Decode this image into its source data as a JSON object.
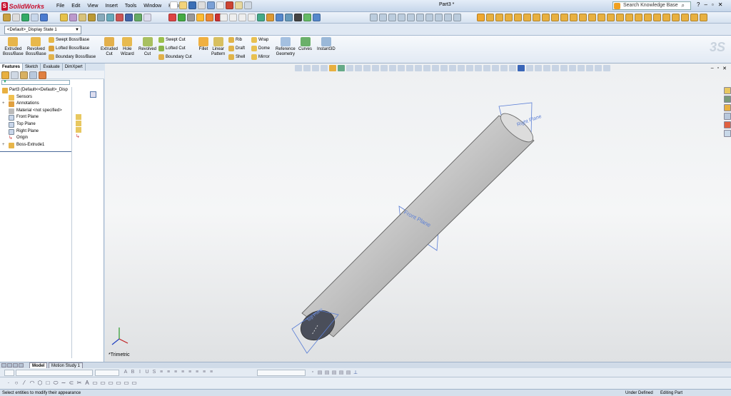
{
  "app": {
    "name": "SolidWorks",
    "doc_title": "Part3 *"
  },
  "menu": [
    "File",
    "Edit",
    "View",
    "Insert",
    "Tools",
    "Window",
    "Help"
  ],
  "search": {
    "placeholder": "Search Knowledge Base"
  },
  "config": {
    "selected": "<Default>_Display State 1"
  },
  "commands": {
    "extruded_boss": "Extruded\nBoss/Base",
    "revolved_boss": "Revolved\nBoss/Base",
    "swept_boss": "Swept Boss/Base",
    "lofted_boss": "Lofted Boss/Base",
    "boundary_boss": "Boundary Boss/Base",
    "extruded_cut": "Extruded\nCut",
    "hole_wizard": "Hole\nWizard",
    "revolved_cut": "Revolved\nCut",
    "swept_cut": "Swept Cut",
    "lofted_cut": "Lofted Cut",
    "boundary_cut": "Boundary Cut",
    "fillet": "Fillet",
    "linear_pattern": "Linear\nPattern",
    "rib": "Rib",
    "draft": "Draft",
    "shell": "Shell",
    "wrap": "Wrap",
    "dome": "Dome",
    "mirror": "Mirror",
    "reference_geometry": "Reference\nGeometry",
    "curves": "Curves",
    "instant3d": "Instant3D"
  },
  "panel_tabs": [
    "Features",
    "Sketch",
    "Evaluate",
    "DimXpert"
  ],
  "tree": {
    "root": "Part3  (Default<<Default>_Disp",
    "sensors": "Sensors",
    "annotations": "Annotations",
    "material": "Material <not specified>",
    "front_plane": "Front Plane",
    "top_plane": "Top Plane",
    "right_plane": "Right Plane",
    "origin": "Origin",
    "boss_extrude": "Boss-Extrude1"
  },
  "viewport": {
    "view_label": "*Trimetric",
    "plane_labels": {
      "front": "Front Plane",
      "right": "Right Plane",
      "top": "Top Plane"
    },
    "colors": {
      "planes": "#5b7fd6",
      "body": "#c4c4c4"
    }
  },
  "bottom_tabs": {
    "model": "Model",
    "motion": "Motion Study 1"
  },
  "status": {
    "message": "Select entities to modify their appearance",
    "state": "Under Defined",
    "mode": "Editing Part"
  }
}
